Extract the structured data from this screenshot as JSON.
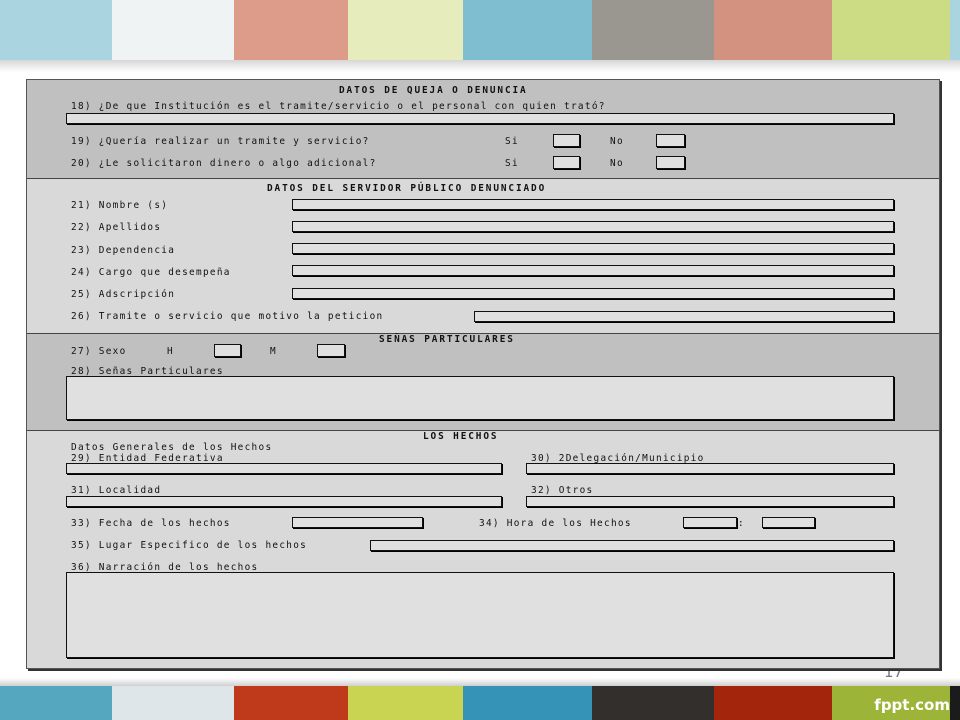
{
  "colors": {
    "top_band": [
      "#a9d4e0",
      "#f0f3f4",
      "#dd9c8a",
      "#e7ecbc",
      "#7fbdd0",
      "#9a9791",
      "#d3917f",
      "#ccdc85",
      "#a9d4e0"
    ],
    "bottom_band": [
      "#54a7bf",
      "#dfe6e9",
      "#bf3a1b",
      "#c9d552",
      "#3593b8",
      "#332f2c",
      "#a3260c",
      "#9cb539",
      "#1b1b1b"
    ]
  },
  "footer": {
    "page_number": "17",
    "logo": "fppt.com"
  },
  "form": {
    "s1": {
      "title": "DATOS DE QUEJA O DENUNCIA",
      "q18": "18) ¿De que Institución es el tramite/servicio o el personal con quien trató?",
      "q19": "19) ¿Quería realizar un tramite y servicio?",
      "q20": "20) ¿Le solicitaron dinero o algo adicional?",
      "si": "Si",
      "no": "No"
    },
    "s2": {
      "title": "DATOS DEL SERVIDOR PÚBLICO DENUNCIADO",
      "q21": "21) Nombre (s)",
      "q22": "22) Apellidos",
      "q23": "23) Dependencia",
      "q24": "24) Cargo que desempeña",
      "q25": "25) Adscripción",
      "q26": "26) Tramite o servicio que motivo la peticion"
    },
    "s3": {
      "title": "SEÑAS PARTICULARES",
      "q27": "27) Sexo",
      "h": "H",
      "m": "M",
      "q28": "28) Señas Particulares"
    },
    "s4": {
      "title": "LOS HECHOS",
      "subtitle": "Datos Generales de los Hechos",
      "q29": "29) Entidad Federativa",
      "q30": "30) 2Delegación/Municipio",
      "q31": "31) Localidad",
      "q32": "32) Otros",
      "q33": "33) Fecha de los hechos",
      "q34": "34) Hora de los Hechos",
      "colon": ":",
      "q35": "35) Lugar Especifico de los hechos",
      "q36": "36) Narración de los hechos"
    }
  }
}
